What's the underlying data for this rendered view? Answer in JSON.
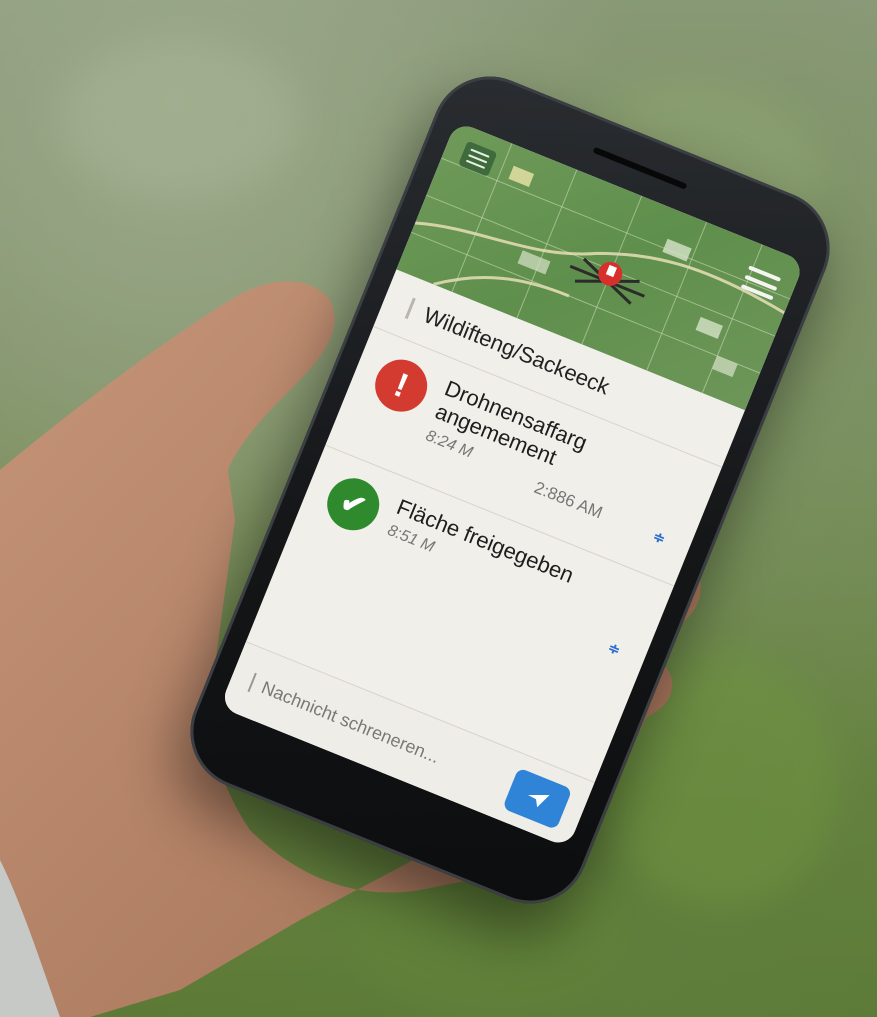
{
  "app": {
    "header": {
      "title": "Wildifteng/Sackeeck"
    },
    "messages": [
      {
        "title": "Drohnensaffarg angemement",
        "time": "8:24 M",
        "time_secondary": "2:886 AM",
        "status_icon": "alert-exclamation-icon",
        "mark": "≑"
      },
      {
        "title": "Fläche freigegeben",
        "time": "8:51 M",
        "status_icon": "check-icon",
        "mark": "≑"
      }
    ],
    "composer": {
      "placeholder": "Nachnicht schreneren..."
    },
    "colors": {
      "alert": "#d43b30",
      "ok": "#2f8a2e",
      "send": "#2f84d8",
      "map_bg": "#6f9a5a"
    },
    "icons": [
      "menu-icon",
      "list-icon",
      "map-marker-icon",
      "send-icon"
    ]
  }
}
